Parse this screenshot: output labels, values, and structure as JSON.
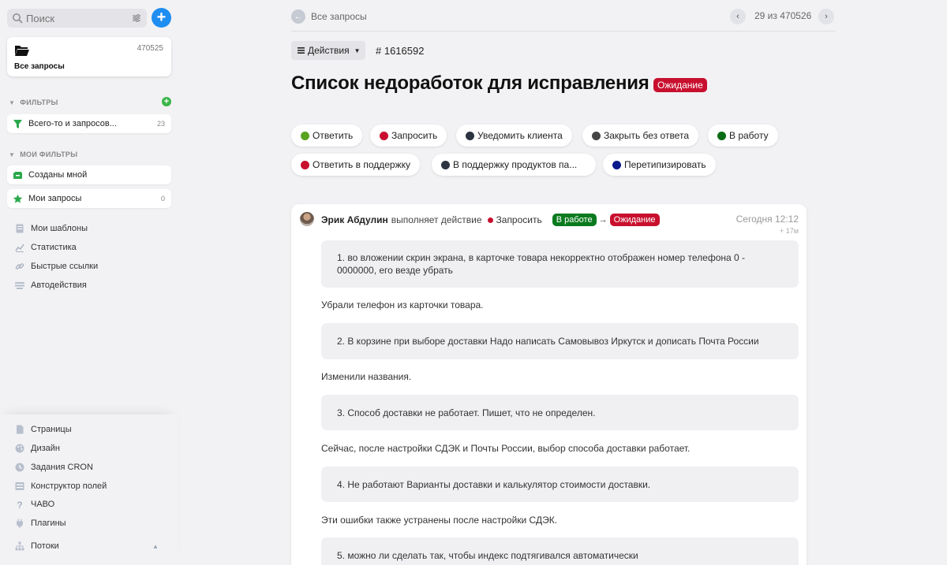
{
  "sidebar": {
    "search_placeholder": "Поиск",
    "add_label": "+",
    "all_requests": {
      "label": "Все запросы",
      "count": "470525"
    },
    "filters_header": "ФИЛЬТРЫ",
    "filters": [
      {
        "label": "Всего-то и запросов...",
        "count": "23"
      }
    ],
    "my_filters_header": "МОИ ФИЛЬТРЫ",
    "my_filters": [
      {
        "label": "Созданы мной",
        "count": ""
      },
      {
        "label": "Мои запросы",
        "count": "0"
      }
    ],
    "nav": [
      "Мои шаблоны",
      "Статистика",
      "Быстрые ссылки",
      "Автодействия"
    ],
    "bottom_nav": [
      "Страницы",
      "Дизайн",
      "Задания CRON",
      "Конструктор полей",
      "ЧАВО",
      "Плагины",
      "Потоки"
    ]
  },
  "topbar": {
    "back_label": "Все запросы",
    "pager_text": "29 из 470526",
    "prev": "‹",
    "next": "›"
  },
  "request": {
    "actions_label": "Действия",
    "id": "# 1616592",
    "title": "Список недоработок для исправления",
    "status": "Ожидание"
  },
  "action_buttons": [
    {
      "label": "Ответить",
      "color": "#5aa321"
    },
    {
      "label": "Запросить",
      "color": "#c8102e"
    },
    {
      "label": "Уведомить клиента",
      "color": "#2b3440"
    },
    {
      "label": "Закрыть без ответа",
      "color": "#444444"
    },
    {
      "label": "В работу",
      "color": "#0a6b14"
    },
    {
      "label": "Ответить в поддержку",
      "color": "#c8102e"
    },
    {
      "label": "В поддержку продуктов па...",
      "color": "#2b3440"
    },
    {
      "label": "Перетипизировать",
      "color": "#0a1a8c"
    }
  ],
  "event": {
    "author": "Эрик Абдулин",
    "action_text": "выполняет действие",
    "action_name": "Запросить",
    "from_status": "В работе",
    "arrow": "→",
    "to_status": "Ожидание",
    "time": "Сегодня 12:12",
    "time_sub": "+ 17м"
  },
  "thread": [
    {
      "type": "quote",
      "text": "1. во вложении скрин экрана, в карточке товара некорректно отображен номер телефона 0 - 0000000, его везде убрать"
    },
    {
      "type": "reply",
      "text": "Убрали телефон из карточки товара."
    },
    {
      "type": "quote",
      "text": "2. В корзине при выборе доставки Надо написать Самовывоз Иркутск и дописать Почта России"
    },
    {
      "type": "reply",
      "text": "Изменили названия."
    },
    {
      "type": "quote",
      "text": "3. Способ доставки не работает. Пишет, что не определен."
    },
    {
      "type": "reply",
      "text": "Сейчас, после настройки СДЭК и Почты России, выбор способа доставки работает."
    },
    {
      "type": "quote",
      "text": "4. Не работают Варианты доставки и калькулятор стоимости доставки."
    },
    {
      "type": "reply",
      "text": "Эти ошибки также устранены после настройки СДЭК."
    },
    {
      "type": "quote",
      "text": "5. можно ли сделать так, чтобы индекс подтягивался автоматически"
    }
  ]
}
